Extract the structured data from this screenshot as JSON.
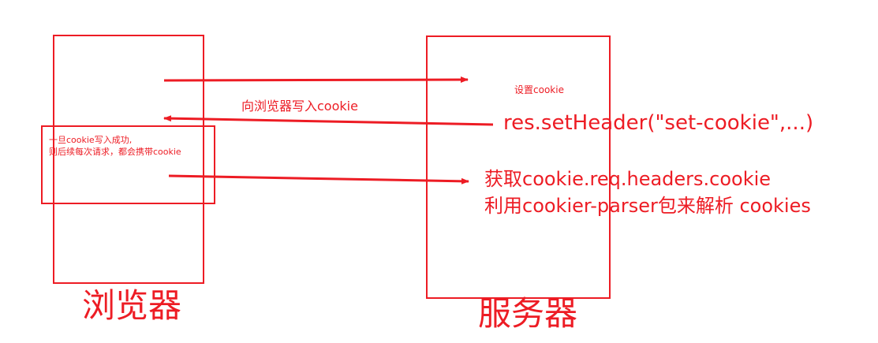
{
  "colors": {
    "accent": "#ed1c24"
  },
  "browser": {
    "label": "浏览器"
  },
  "server": {
    "label": "服务器"
  },
  "annotations": {
    "set_cookie": "设置cookie",
    "write_cookie": "向浏览器写入cookie",
    "set_header": "res.setHeader(\"set-cookie\",...)",
    "once_success_line1": "一旦cookie写入成功,",
    "once_success_line2": "则后续每次请求，都会携带cookie",
    "get_cookie_line1": "获取cookie.req.headers.cookie",
    "get_cookie_line2": "利用cookier-parser包来解析 cookies"
  }
}
